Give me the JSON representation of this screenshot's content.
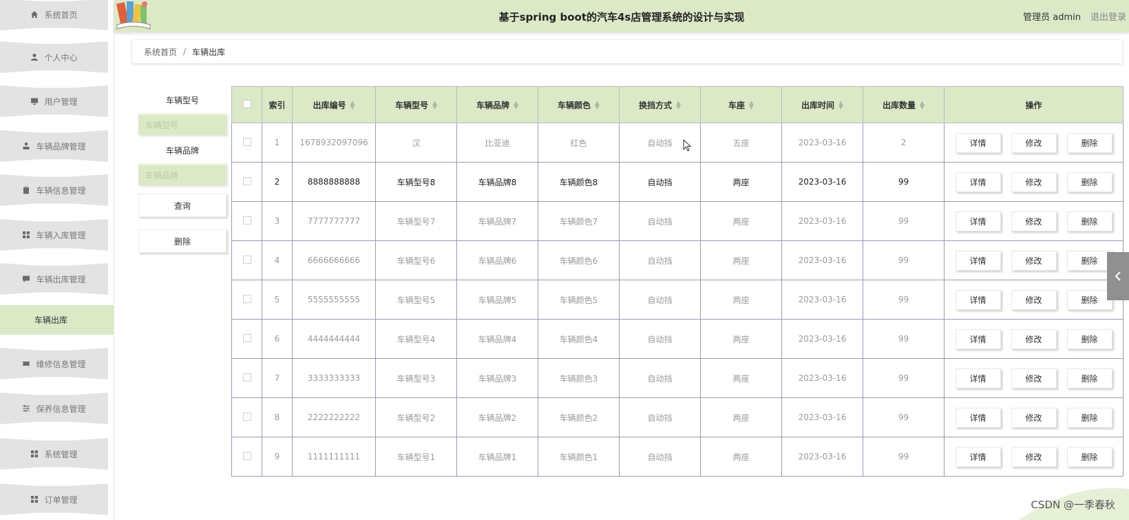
{
  "header": {
    "title": "基于spring boot的汽车4s店管理系统的设计与实现",
    "admin_label": "管理员 admin",
    "logout_label": "退出登录"
  },
  "sidebar": {
    "items": [
      {
        "label": "系统首页",
        "icon": "home-icon"
      },
      {
        "label": "个人中心",
        "icon": "user-icon"
      },
      {
        "label": "用户管理",
        "icon": "monitor-icon"
      },
      {
        "label": "车辆品牌管理",
        "icon": "person-stand-icon"
      },
      {
        "label": "车辆信息管理",
        "icon": "clipboard-icon"
      },
      {
        "label": "车辆入库管理",
        "icon": "grid-icon"
      },
      {
        "label": "车辆出库管理",
        "icon": "chat-icon"
      },
      {
        "label": "维修信息管理",
        "icon": "ticket-icon"
      },
      {
        "label": "保养信息管理",
        "icon": "sliders-icon"
      },
      {
        "label": "系统管理",
        "icon": "grid-icon"
      },
      {
        "label": "订单管理",
        "icon": "grid-icon"
      }
    ],
    "active_sub": "车辆出库"
  },
  "breadcrumb": {
    "home": "系统首页",
    "separator": "/",
    "current": "车辆出库"
  },
  "search": {
    "model_label": "车辆型号",
    "model_placeholder": "车辆型号",
    "brand_label": "车辆品牌",
    "brand_placeholder": "车辆品牌",
    "query_button": "查询",
    "delete_button": "删除"
  },
  "table": {
    "columns": [
      "索引",
      "出库编号",
      "车辆型号",
      "车辆品牌",
      "车辆颜色",
      "换挡方式",
      "车座",
      "出库时间",
      "出库数量",
      "操作"
    ],
    "action_labels": {
      "detail": "详情",
      "edit": "修改",
      "delete": "删除"
    },
    "rows": [
      [
        "1",
        "1678932097096",
        "汉",
        "比亚迪",
        "红色",
        "自动挡",
        "五座",
        "2023-03-16",
        "2"
      ],
      [
        "2",
        "8888888888",
        "车辆型号8",
        "车辆品牌8",
        "车辆颜色8",
        "自动挡",
        "两座",
        "2023-03-16",
        "99"
      ],
      [
        "3",
        "7777777777",
        "车辆型号7",
        "车辆品牌7",
        "车辆颜色7",
        "自动挡",
        "两座",
        "2023-03-16",
        "99"
      ],
      [
        "4",
        "6666666666",
        "车辆型号6",
        "车辆品牌6",
        "车辆颜色6",
        "自动挡",
        "两座",
        "2023-03-16",
        "99"
      ],
      [
        "5",
        "5555555555",
        "车辆型号5",
        "车辆品牌5",
        "车辆颜色5",
        "自动挡",
        "两座",
        "2023-03-16",
        "99"
      ],
      [
        "6",
        "4444444444",
        "车辆型号4",
        "车辆品牌4",
        "车辆颜色4",
        "自动挡",
        "两座",
        "2023-03-16",
        "99"
      ],
      [
        "7",
        "3333333333",
        "车辆型号3",
        "车辆品牌3",
        "车辆颜色3",
        "自动挡",
        "两座",
        "2023-03-16",
        "99"
      ],
      [
        "8",
        "2222222222",
        "车辆型号2",
        "车辆品牌2",
        "车辆颜色2",
        "自动挡",
        "两座",
        "2023-03-16",
        "99"
      ],
      [
        "9",
        "1111111111",
        "车辆型号1",
        "车辆品牌1",
        "车辆颜色1",
        "自动挡",
        "两座",
        "2023-03-16",
        "99"
      ]
    ]
  },
  "watermark": "CSDN @一季春秋",
  "colors": {
    "accent": "#dce9c6",
    "sidebar_item": "#e3e3e3",
    "border": "#9a9ab0"
  }
}
